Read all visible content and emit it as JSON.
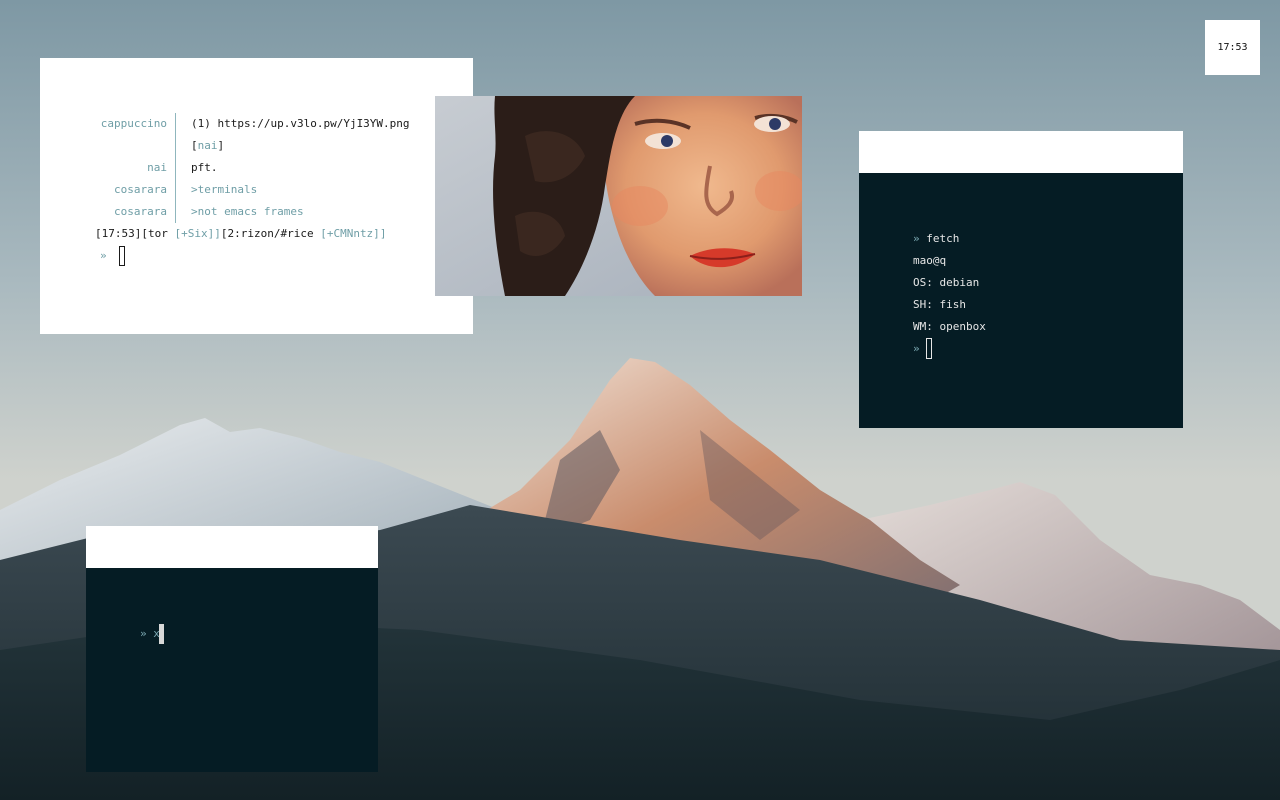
{
  "clock": {
    "time": "17:53"
  },
  "irc": {
    "messages": [
      {
        "nick": "cappuccino",
        "text": "(1) https://up.v3lo.pw/YjI3YW.png"
      },
      {
        "nick": "",
        "text_open": "[",
        "text_nick": "nai",
        "text_close": "]"
      },
      {
        "nick": "nai",
        "text": "pft."
      },
      {
        "nick": "cosarara",
        "text": ">terminals"
      },
      {
        "nick": "cosarara",
        "text": ">not emacs frames"
      }
    ],
    "status": {
      "time": "[17:53]",
      "net": "[tor",
      "mode1": "[+Six]",
      "close1": "]",
      "chan": "[2:rizon/#rice",
      "mode2": "[+CMNntz]",
      "close2": "]"
    },
    "prompt": "»"
  },
  "fetch_terminal": {
    "lines": [
      {
        "prefix": "»",
        "text": " fetch"
      },
      {
        "prefix": "",
        "text": "mao@q"
      },
      {
        "prefix": "",
        "text": "OS: debian"
      },
      {
        "prefix": "",
        "text": "SH: fish"
      },
      {
        "prefix": "",
        "text": "WM: openbox"
      }
    ],
    "prompt": "»"
  },
  "bottom_terminal": {
    "prompt": "» x"
  },
  "colors": {
    "accent": "#6f9ea6",
    "terminal_bg": "#051c24",
    "window_bg": "#ffffff"
  }
}
